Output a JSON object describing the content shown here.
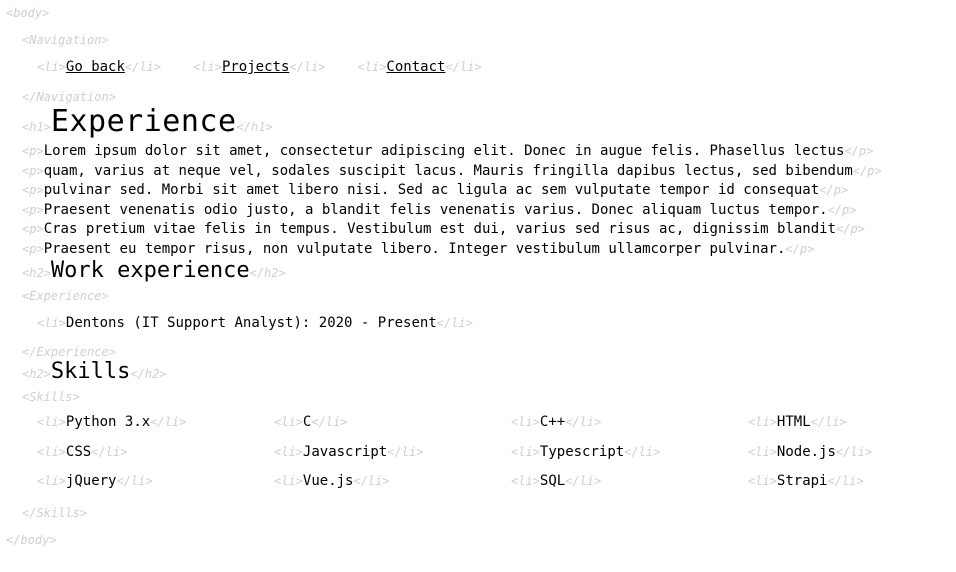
{
  "tags": {
    "body_open": "<body>",
    "body_close": "</body>",
    "nav_open": "<Navigation>",
    "nav_close": "</Navigation>",
    "li_open": "<li>",
    "li_close": "</li>",
    "h1_open": "<h1>",
    "h1_close": "</h1>",
    "p_open": "<p>",
    "p_close": "</p>",
    "h2_open": "<h2>",
    "h2_close": "</h2>",
    "exp_open": "<Experience>",
    "exp_close": "</Experience>",
    "skills_open": "<Skills>",
    "skills_close": "</Skills>"
  },
  "navigation": {
    "items": [
      {
        "label": "Go back"
      },
      {
        "label": "Projects"
      },
      {
        "label": "Contact"
      }
    ]
  },
  "heading": "Experience",
  "paragraph_lines": [
    "Lorem ipsum dolor sit amet, consectetur adipiscing elit. Donec in augue felis. Phasellus lectus",
    "quam, varius at neque vel, sodales suscipit lacus. Mauris fringilla dapibus lectus, sed bibendum",
    "pulvinar sed. Morbi sit amet libero nisi. Sed ac ligula ac sem vulputate tempor id consequat",
    "Praesent venenatis odio justo, a blandit felis venenatis varius. Donec aliquam luctus tempor.",
    "Cras pretium vitae felis in tempus. Vestibulum est dui, varius sed risus ac, dignissim blandit",
    "Praesent eu tempor risus, non vulputate libero. Integer vestibulum ullamcorper pulvinar."
  ],
  "work_heading": "Work experience",
  "work_items": [
    "Dentons (IT Support Analyst): 2020 - Present"
  ],
  "skills_heading": "Skills",
  "skills": [
    "Python 3.x",
    "C",
    "C++",
    "HTML",
    "CSS",
    "Javascript",
    "Typescript",
    "Node.js",
    "jQuery",
    "Vue.js",
    "SQL",
    "Strapi"
  ]
}
